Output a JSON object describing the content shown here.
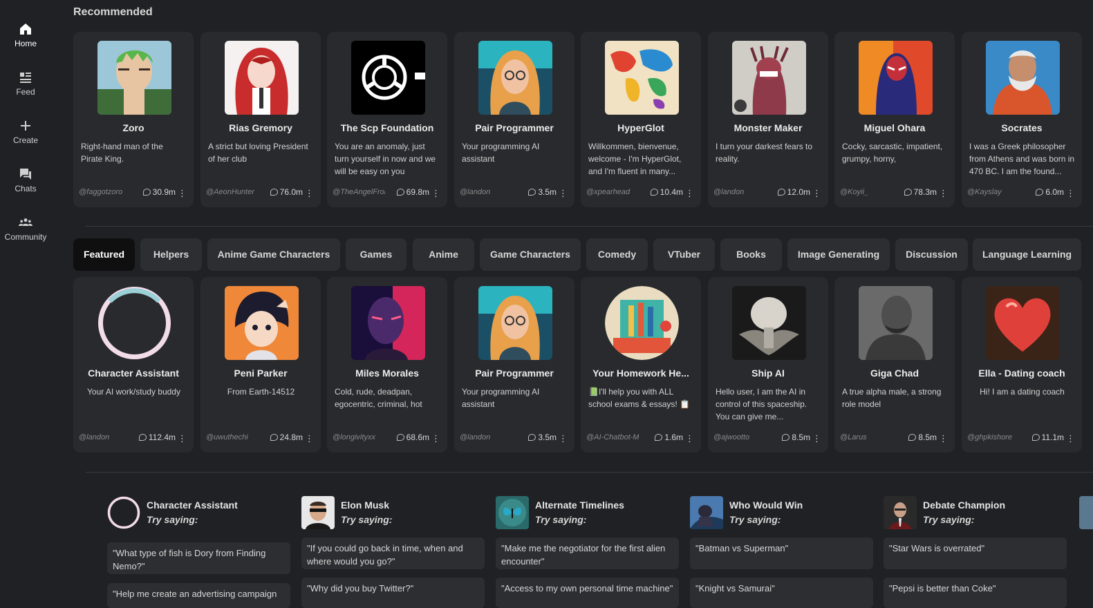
{
  "sidebar": {
    "items": [
      {
        "label": "Home",
        "icon": "home-icon"
      },
      {
        "label": "Feed",
        "icon": "feed-icon"
      },
      {
        "label": "Create",
        "icon": "plus-icon"
      },
      {
        "label": "Chats",
        "icon": "chat-icon"
      },
      {
        "label": "Community",
        "icon": "community-icon"
      }
    ]
  },
  "recommended": {
    "title": "Recommended",
    "cards": [
      {
        "name": "Zoro",
        "desc": "Right-hand man of the Pirate King.",
        "author": "@faggotzoro",
        "count": "30.9m",
        "menu": "⋮"
      },
      {
        "name": "Rias Gremory",
        "desc": "A strict but loving President of her club",
        "author": "@AeonHunter",
        "count": "76.0m",
        "menu": "⋮"
      },
      {
        "name": "The Scp Foundation",
        "desc": "You are an anomaly, just turn yourself in now and we will be easy on you",
        "author": "@TheAngelFrom",
        "count": "69.8m",
        "menu": "⋮"
      },
      {
        "name": "Pair Programmer",
        "desc": "Your programming AI assistant",
        "author": "@landon",
        "count": "3.5m",
        "menu": "⋮"
      },
      {
        "name": "HyperGlot",
        "desc": "Willkommen, bienvenue, welcome - I'm HyperGlot, and I'm fluent in many...",
        "author": "@xpearhead",
        "count": "10.4m",
        "menu": "⋮"
      },
      {
        "name": "Monster Maker",
        "desc": "I turn your darkest fears to reality.",
        "author": "@landon",
        "count": "12.0m",
        "menu": "⋮"
      },
      {
        "name": "Miguel Ohara",
        "desc": "Cocky, sarcastic, impatient, grumpy, horny,",
        "author": "@Koyii_",
        "count": "78.3m",
        "menu": "⋮"
      },
      {
        "name": "Socrates",
        "desc": "I was a Greek philosopher from Athens and was born in 470 BC. I am the found...",
        "author": "@Kayslay",
        "count": "6.0m",
        "menu": "⋮"
      }
    ]
  },
  "categories": {
    "tabs": [
      "Featured",
      "Helpers",
      "Anime Game Characters",
      "Games",
      "Anime",
      "Game Characters",
      "Comedy",
      "VTuber",
      "Books",
      "Image Generating",
      "Discussion",
      "Language Learning"
    ],
    "active": "Featured"
  },
  "featured": {
    "cards": [
      {
        "name": "Character Assistant",
        "desc": "Your AI work/study buddy",
        "author": "@landon",
        "count": "112.4m",
        "menu": "⋮"
      },
      {
        "name": "Peni Parker",
        "desc": "From Earth-14512",
        "author": "@uwuthechi",
        "count": "24.8m",
        "menu": "⋮"
      },
      {
        "name": "Miles Morales",
        "desc": "Cold, rude, deadpan, egocentric, criminal, hot",
        "author": "@longivityxx",
        "count": "68.6m",
        "menu": "⋮"
      },
      {
        "name": "Pair Programmer",
        "desc": "Your programming AI assistant",
        "author": "@landon",
        "count": "3.5m",
        "menu": "⋮"
      },
      {
        "name": "Your Homework He...",
        "desc": "📗I'll help you with ALL school exams & essays! 📋",
        "author": "@AI-Chatbot-Mc",
        "count": "1.6m",
        "menu": "⋮"
      },
      {
        "name": "Ship AI",
        "desc": "Hello user, I am the AI in control of this spaceship. You can give me...",
        "author": "@ajwootto",
        "count": "8.5m",
        "menu": "⋮"
      },
      {
        "name": "Giga Chad",
        "desc": "A true alpha male, a strong role model",
        "author": "@Larus",
        "count": "8.5m",
        "menu": "⋮"
      },
      {
        "name": "Ella - Dating coach",
        "desc": "Hi! I am a dating coach",
        "author": "@ghpkishore",
        "count": "11.1m",
        "menu": "⋮"
      }
    ]
  },
  "try_saying": {
    "label": "Try saying:",
    "columns": [
      {
        "name": "Character Assistant",
        "prompts": [
          "\"What type of fish is Dory from Finding Nemo?\"",
          "\"Help me create an advertising campaign"
        ]
      },
      {
        "name": "Elon Musk",
        "prompts": [
          "\"If you could go back in time, when and where would you go?\"",
          "\"Why did you buy Twitter?\""
        ]
      },
      {
        "name": "Alternate Timelines",
        "prompts": [
          "\"Make me the negotiator for the first alien encounter\"",
          "\"Access to my own personal time machine\""
        ]
      },
      {
        "name": "Who Would Win",
        "prompts": [
          "\"Batman vs Superman\"",
          "\"Knight vs Samurai\""
        ]
      },
      {
        "name": "Debate Champion",
        "prompts": [
          "\"Star Wars is overrated\"",
          "\"Pepsi is better than Coke\""
        ]
      }
    ]
  }
}
